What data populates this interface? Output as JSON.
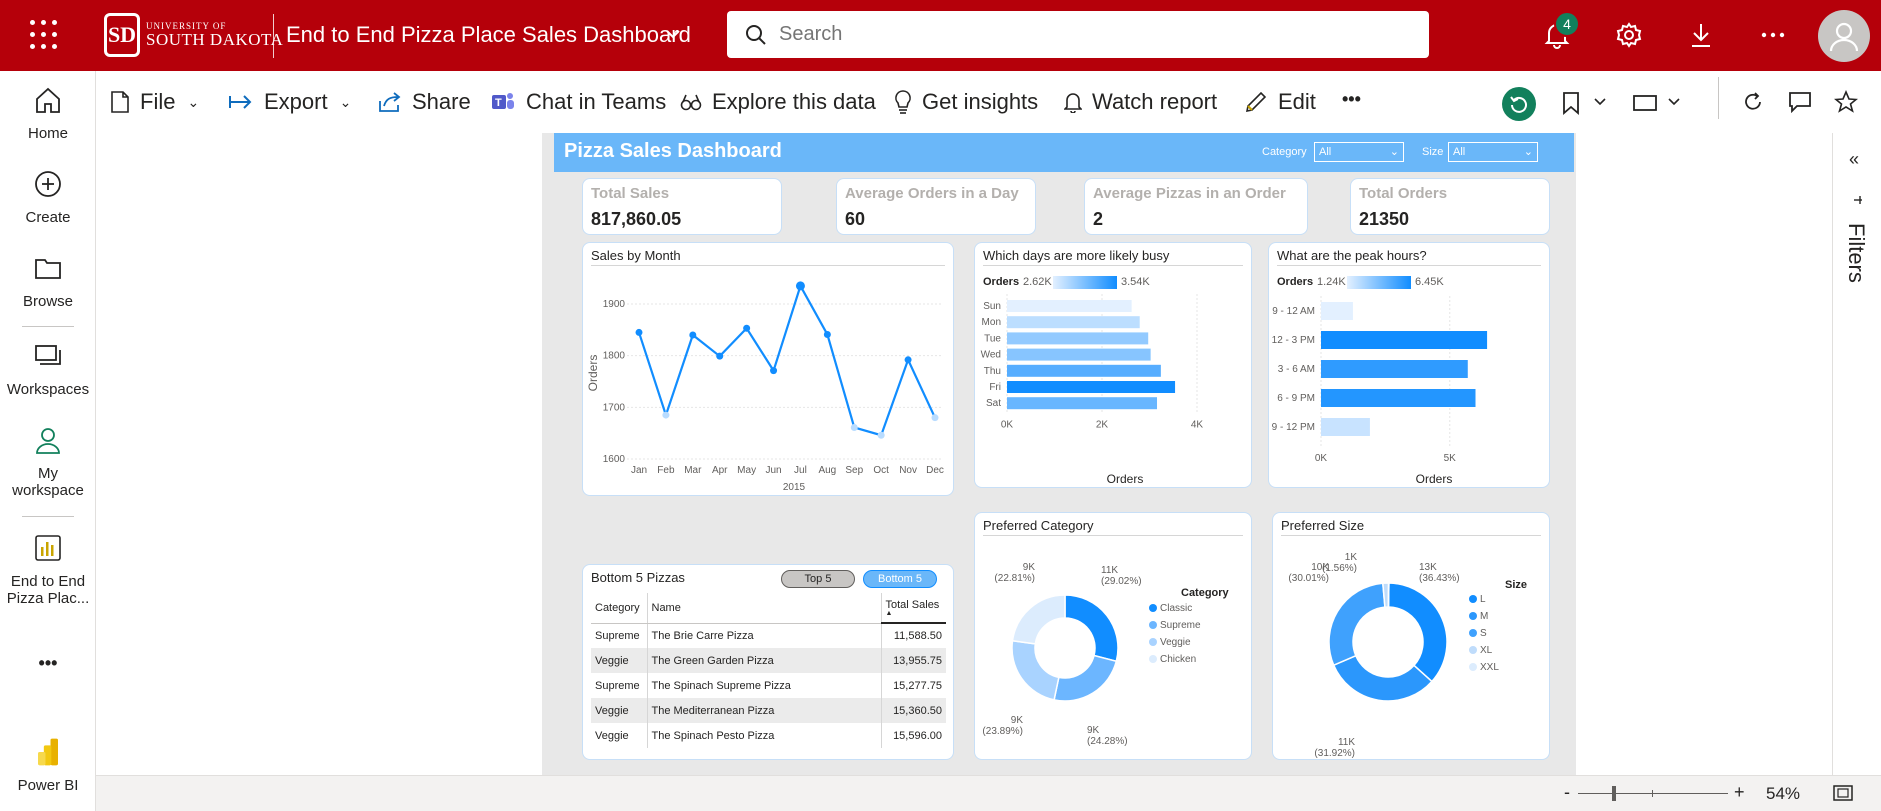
{
  "topbar": {
    "logo_line1": "UNIVERSITY OF",
    "logo_line2": "SOUTH DAKOTA",
    "app_title": "End to End Pizza Place Sales Dashboard",
    "search_placeholder": "Search",
    "notification_count": "4"
  },
  "leftnav": {
    "home": "Home",
    "create": "Create",
    "browse": "Browse",
    "workspaces": "Workspaces",
    "my_workspace_1": "My",
    "my_workspace_2": "workspace",
    "report_1": "End to End",
    "report_2": "Pizza Plac...",
    "more": "•••",
    "powerbi": "Power BI"
  },
  "actionbar": {
    "file": "File",
    "export": "Export",
    "share": "Share",
    "chat": "Chat in Teams",
    "explore": "Explore this data",
    "insights": "Get insights",
    "watch": "Watch report",
    "edit": "Edit",
    "more": "•••"
  },
  "report": {
    "title": "Pizza Sales Dashboard",
    "category_label": "Category",
    "category_value": "All",
    "size_label": "Size",
    "size_value": "All",
    "kpis": [
      {
        "label": "Total Sales",
        "value": "817,860.05"
      },
      {
        "label": "Average Orders in a Day",
        "value": "60"
      },
      {
        "label": "Average Pizzas in an Order",
        "value": "2"
      },
      {
        "label": "Total Orders",
        "value": "21350"
      }
    ],
    "table": {
      "title": "Bottom 5 Pizzas",
      "toggle_top": "Top 5",
      "toggle_bottom": "Bottom 5",
      "columns": [
        "Category",
        "Name",
        "Total Sales"
      ],
      "rows": [
        [
          "Supreme",
          "The Brie Carre Pizza",
          "11,588.50"
        ],
        [
          "Veggie",
          "The Green Garden Pizza",
          "13,955.75"
        ],
        [
          "Supreme",
          "The Spinach Supreme Pizza",
          "15,277.75"
        ],
        [
          "Veggie",
          "The Mediterranean Pizza",
          "15,360.50"
        ],
        [
          "Veggie",
          "The Spinach Pesto Pizza",
          "15,596.00"
        ]
      ]
    }
  },
  "statusbar": {
    "zoom_minus": "-",
    "zoom_plus": "+",
    "zoom": "54%"
  },
  "filters_label": "Filters",
  "chart_data": [
    {
      "type": "line",
      "title": "Sales by Month",
      "xlabel": "2015",
      "ylabel": "Orders",
      "categories": [
        "Jan",
        "Feb",
        "Mar",
        "Apr",
        "May",
        "Jun",
        "Jul",
        "Aug",
        "Sep",
        "Oct",
        "Nov",
        "Dec"
      ],
      "values": [
        1845,
        1685,
        1840,
        1799,
        1853,
        1771,
        1935,
        1841,
        1661,
        1646,
        1792,
        1680
      ],
      "yticks": [
        "1600",
        "1700",
        "1800",
        "1900"
      ],
      "ylim": [
        1600,
        1960
      ],
      "color": "#118dff"
    },
    {
      "type": "bar",
      "title": "Which days are more likely busy",
      "legend_label": "Orders",
      "legend_min": "2.62K",
      "legend_max": "3.54K",
      "categories": [
        "Sun",
        "Mon",
        "Tue",
        "Wed",
        "Thu",
        "Fri",
        "Sat"
      ],
      "values": [
        2624,
        2794,
        2973,
        3024,
        3239,
        3538,
        3158
      ],
      "xlabel": "Orders",
      "xticks": [
        "0K",
        "2K",
        "4K"
      ],
      "xlim": [
        0,
        4000
      ]
    },
    {
      "type": "bar",
      "title": "What are the peak hours?",
      "legend_label": "Orders",
      "legend_min": "1.24K",
      "legend_max": "6.45K",
      "categories": [
        "9 - 12 AM",
        "12 - 3 PM",
        "3 - 6 AM",
        "6 - 9 PM",
        "9 - 12 PM"
      ],
      "values": [
        1240,
        6450,
        5700,
        6000,
        1900
      ],
      "xlabel": "Orders",
      "xticks": [
        "0K",
        "5K"
      ],
      "xlim": [
        0,
        8000
      ]
    },
    {
      "type": "pie",
      "title": "Preferred Category",
      "legend_title": "Category",
      "labels": [
        "Classic",
        "Supreme",
        "Veggie",
        "Chicken"
      ],
      "values": [
        29.02,
        24.28,
        23.89,
        22.81
      ],
      "slice_labels": [
        "11K (29.02%)",
        "9K (24.28%)",
        "9K (23.89%)",
        "9K (22.81%)"
      ],
      "colors": [
        "#118dff",
        "#6cb6ff",
        "#a9d3ff",
        "#dcecfd"
      ]
    },
    {
      "type": "pie",
      "title": "Preferred Size",
      "legend_title": "Size",
      "labels": [
        "L",
        "M",
        "S",
        "XL",
        "XXL"
      ],
      "values": [
        36.43,
        31.92,
        30.01,
        1.56,
        0.08
      ],
      "slice_labels": [
        "13K (36.43%)",
        "11K (31.92%)",
        "10K (30.01%)",
        "1K (1.56%)",
        ""
      ],
      "colors": [
        "#118dff",
        "#2b97fc",
        "#3fa1fd",
        "#bfdcfb",
        "#dcecfd"
      ]
    }
  ],
  "colors": {
    "topbar": "#b5000a",
    "accent": "#118dff",
    "banner": "#6ab7f9",
    "badge": "#12805c"
  }
}
